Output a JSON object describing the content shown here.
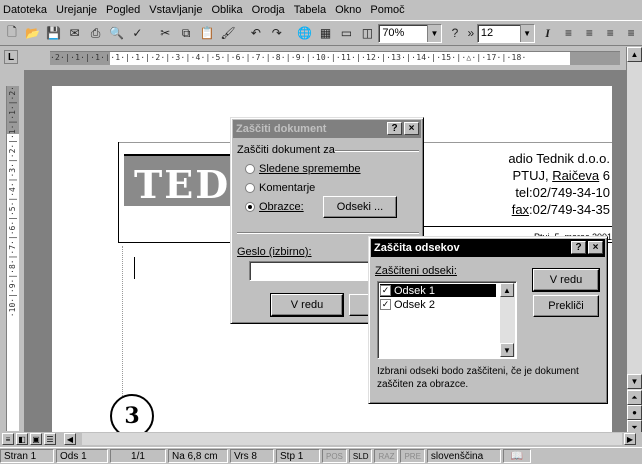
{
  "menu": [
    "Datoteka",
    "Urejanje",
    "Pogled",
    "Vstavljanje",
    "Oblika",
    "Orodja",
    "Tabela",
    "Okno",
    "Pomoč"
  ],
  "toolbar": {
    "zoom": "70%",
    "font_size": "12"
  },
  "ruler": {
    "h_ticks": "·2·|·1·|·1·❘·1·|·1·|·2·|·3·|·4·|·5·|·6·|·7·|·8·|·9·|·10·|·11·|·12·|·13·|·14·|·15·|·△·|·17·|·18·",
    "v_ticks": "·10·|·9·|·8·|·7·|·6·|·5·|·4·|·3·|·2·|·1·|·1·|·2·"
  },
  "document": {
    "logo": "TEDNIK",
    "address": [
      "adio Tednik d.o.o.",
      "PTUJ, Raičeva 6",
      "tel:02/749-34-10",
      "fax:02/749-34-35"
    ],
    "date_line": "Ptuj, 5. marec 2001",
    "badge": "3"
  },
  "dialog_protect": {
    "title": "Zaščiti dokument",
    "help": "?",
    "close": "×",
    "group_label": "Zaščiti dokument za",
    "options": [
      "Sledene spremembe",
      "Komentarje",
      "Obrazce:"
    ],
    "selected_option": 2,
    "sections_button": "Odseki ...",
    "password_label": "Geslo (izbirno):",
    "password_value": "",
    "ok": "V redu",
    "cancel_partial": "P"
  },
  "dialog_sections": {
    "title": "Zaščita odsekov",
    "help": "?",
    "close": "×",
    "list_label": "Zaščiteni odseki:",
    "items": [
      {
        "label": "Odsek 1",
        "checked": true,
        "selected": true
      },
      {
        "label": "Odsek 2",
        "checked": true,
        "selected": false
      }
    ],
    "ok": "V redu",
    "cancel": "Prekliči",
    "note": "Izbrani odseki bodo zaščiteni, če je dokument zaščiten za obrazce."
  },
  "status": {
    "page": "Stran 1",
    "section": "Ods 1",
    "pages": "1/1",
    "at": "Na 6,8 cm",
    "line": "Vrs 8",
    "col": "Stp 1",
    "rec": "POS",
    "trk": "SLD",
    "ext": "RAZ",
    "ovr": "PRE",
    "language": "slovenščina",
    "spell_icon": "book-check-icon"
  }
}
